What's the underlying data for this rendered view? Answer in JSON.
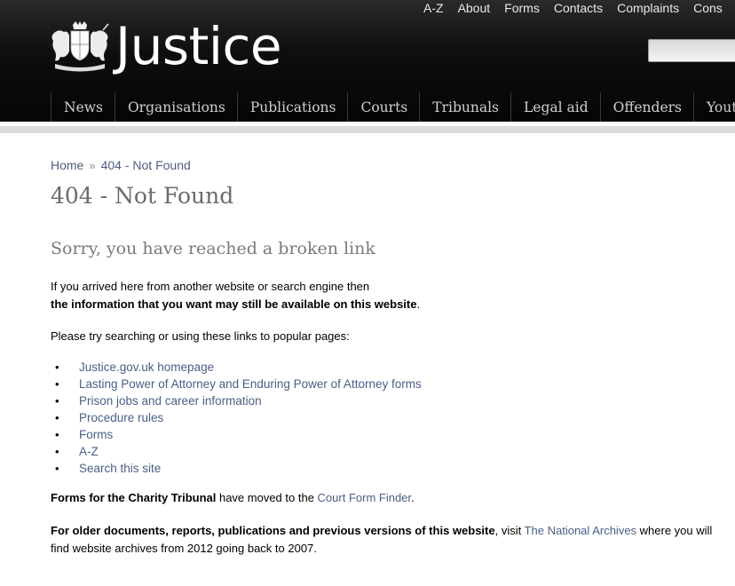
{
  "header": {
    "site_title": "Justice",
    "util_links": [
      "A-Z",
      "About",
      "Forms",
      "Contacts",
      "Complaints",
      "Cons"
    ],
    "nav_items": [
      "News",
      "Organisations",
      "Publications",
      "Courts",
      "Tribunals",
      "Legal aid",
      "Offenders",
      "Youth justi"
    ],
    "colors": {
      "header_bg": "#0a0a0a",
      "nav_text": "#d0d0d0"
    }
  },
  "breadcrumb": {
    "home": "Home",
    "separator": "»",
    "current": "404 - Not Found"
  },
  "main": {
    "title": "404 - Not Found",
    "subtitle": "Sorry, you have reached a broken link",
    "intro_line1": "If you arrived here from another website or search engine then",
    "intro_line2": "the information that you want may still be available on this website",
    "intro_line2_end": ".",
    "try_text": "Please try searching or using these links to popular pages:",
    "links": [
      "Justice.gov.uk homepage",
      "Lasting Power of Attorney and Enduring Power of Attorney forms",
      "Prison jobs and career information",
      "Procedure rules",
      "Forms",
      "A-Z",
      "Search this site"
    ],
    "bullet": "•",
    "charity_bold": "Forms for the Charity Tribunal",
    "charity_text": " have moved to the ",
    "charity_link": "Court Form Finder",
    "charity_end": ".",
    "archives_bold": "For older documents, reports, publications and previous versions of this website",
    "archives_text1": ", visit ",
    "archives_link": "The National Archives",
    "archives_text2": " where you will find website archives from 2012 going back to 2007."
  }
}
